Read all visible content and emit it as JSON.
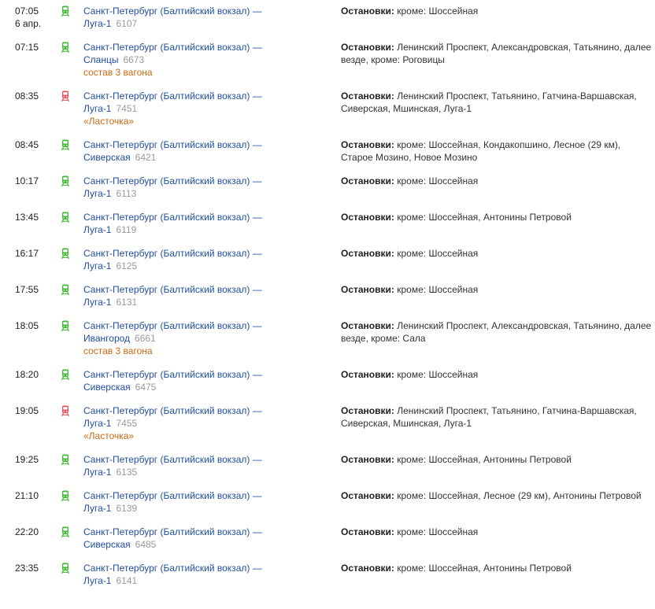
{
  "colors": {
    "link": "#1f4fa0",
    "train_green": "#3fbe33",
    "train_red": "#e65562",
    "note": "#c96a12",
    "number": "#999999"
  },
  "stops_label": "Остановки:",
  "trips": [
    {
      "time": "07:05",
      "date": "6 апр.",
      "icon": "train-green-icon",
      "route_line1": "Санкт-Петербург (Балтийский вокзал) —",
      "dest": "Луга-1",
      "number": "6107",
      "note": "",
      "stops": "кроме: Шоссейная"
    },
    {
      "time": "07:15",
      "date": "",
      "icon": "train-green-icon",
      "route_line1": "Санкт-Петербург (Балтийский вокзал) —",
      "dest": "Сланцы",
      "number": "6673",
      "note": "состав 3 вагона",
      "stops": "Ленинский Проспект, Александровская, Татьянино, далее везде, кроме: Роговицы"
    },
    {
      "time": "08:35",
      "date": "",
      "icon": "train-red-icon",
      "route_line1": "Санкт-Петербург (Балтийский вокзал) —",
      "dest": "Луга-1",
      "number": "7451",
      "note": "«Ласточка»",
      "stops": "Ленинский Проспект, Татьянино, Гатчина-Варшавская, Сиверская, Мшинская, Луга-1"
    },
    {
      "time": "08:45",
      "date": "",
      "icon": "train-green-icon",
      "route_line1": "Санкт-Петербург (Балтийский вокзал) —",
      "dest": "Сиверская",
      "number": "6421",
      "note": "",
      "stops": "кроме: Шоссейная, Кондакопшино, Лесное (29 км), Старое Мозино, Новое Мозино"
    },
    {
      "time": "10:17",
      "date": "",
      "icon": "train-green-icon",
      "route_line1": "Санкт-Петербург (Балтийский вокзал) —",
      "dest": "Луга-1",
      "number": "6113",
      "note": "",
      "stops": "кроме: Шоссейная"
    },
    {
      "time": "13:45",
      "date": "",
      "icon": "train-green-icon",
      "route_line1": "Санкт-Петербург (Балтийский вокзал) —",
      "dest": "Луга-1",
      "number": "6119",
      "note": "",
      "stops": "кроме: Шоссейная, Антонины Петровой"
    },
    {
      "time": "16:17",
      "date": "",
      "icon": "train-green-icon",
      "route_line1": "Санкт-Петербург (Балтийский вокзал) —",
      "dest": "Луга-1",
      "number": "6125",
      "note": "",
      "stops": "кроме: Шоссейная"
    },
    {
      "time": "17:55",
      "date": "",
      "icon": "train-green-icon",
      "route_line1": "Санкт-Петербург (Балтийский вокзал) —",
      "dest": "Луга-1",
      "number": "6131",
      "note": "",
      "stops": "кроме: Шоссейная"
    },
    {
      "time": "18:05",
      "date": "",
      "icon": "train-green-icon",
      "route_line1": "Санкт-Петербург (Балтийский вокзал) —",
      "dest": "Ивангород",
      "number": "6661",
      "note": "состав 3 вагона",
      "stops": "Ленинский Проспект, Александровская, Татьянино, далее везде, кроме: Сала"
    },
    {
      "time": "18:20",
      "date": "",
      "icon": "train-green-icon",
      "route_line1": "Санкт-Петербург (Балтийский вокзал) —",
      "dest": "Сиверская",
      "number": "6475",
      "note": "",
      "stops": "кроме: Шоссейная"
    },
    {
      "time": "19:05",
      "date": "",
      "icon": "train-red-icon",
      "route_line1": "Санкт-Петербург (Балтийский вокзал) —",
      "dest": "Луга-1",
      "number": "7455",
      "note": "«Ласточка»",
      "stops": "Ленинский Проспект, Татьянино, Гатчина-Варшавская, Сиверская, Мшинская, Луга-1"
    },
    {
      "time": "19:25",
      "date": "",
      "icon": "train-green-icon",
      "route_line1": "Санкт-Петербург (Балтийский вокзал) —",
      "dest": "Луга-1",
      "number": "6135",
      "note": "",
      "stops": "кроме: Шоссейная, Антонины Петровой"
    },
    {
      "time": "21:10",
      "date": "",
      "icon": "train-green-icon",
      "route_line1": "Санкт-Петербург (Балтийский вокзал) —",
      "dest": "Луга-1",
      "number": "6139",
      "note": "",
      "stops": "кроме: Шоссейная, Лесное (29 км), Антонины Петровой"
    },
    {
      "time": "22:20",
      "date": "",
      "icon": "train-green-icon",
      "route_line1": "Санкт-Петербург (Балтийский вокзал) —",
      "dest": "Сиверская",
      "number": "6485",
      "note": "",
      "stops": "кроме: Шоссейная"
    },
    {
      "time": "23:35",
      "date": "",
      "icon": "train-green-icon",
      "route_line1": "Санкт-Петербург (Балтийский вокзал) —",
      "dest": "Луга-1",
      "number": "6141",
      "note": "",
      "stops": "кроме: Шоссейная, Антонины Петровой"
    }
  ]
}
